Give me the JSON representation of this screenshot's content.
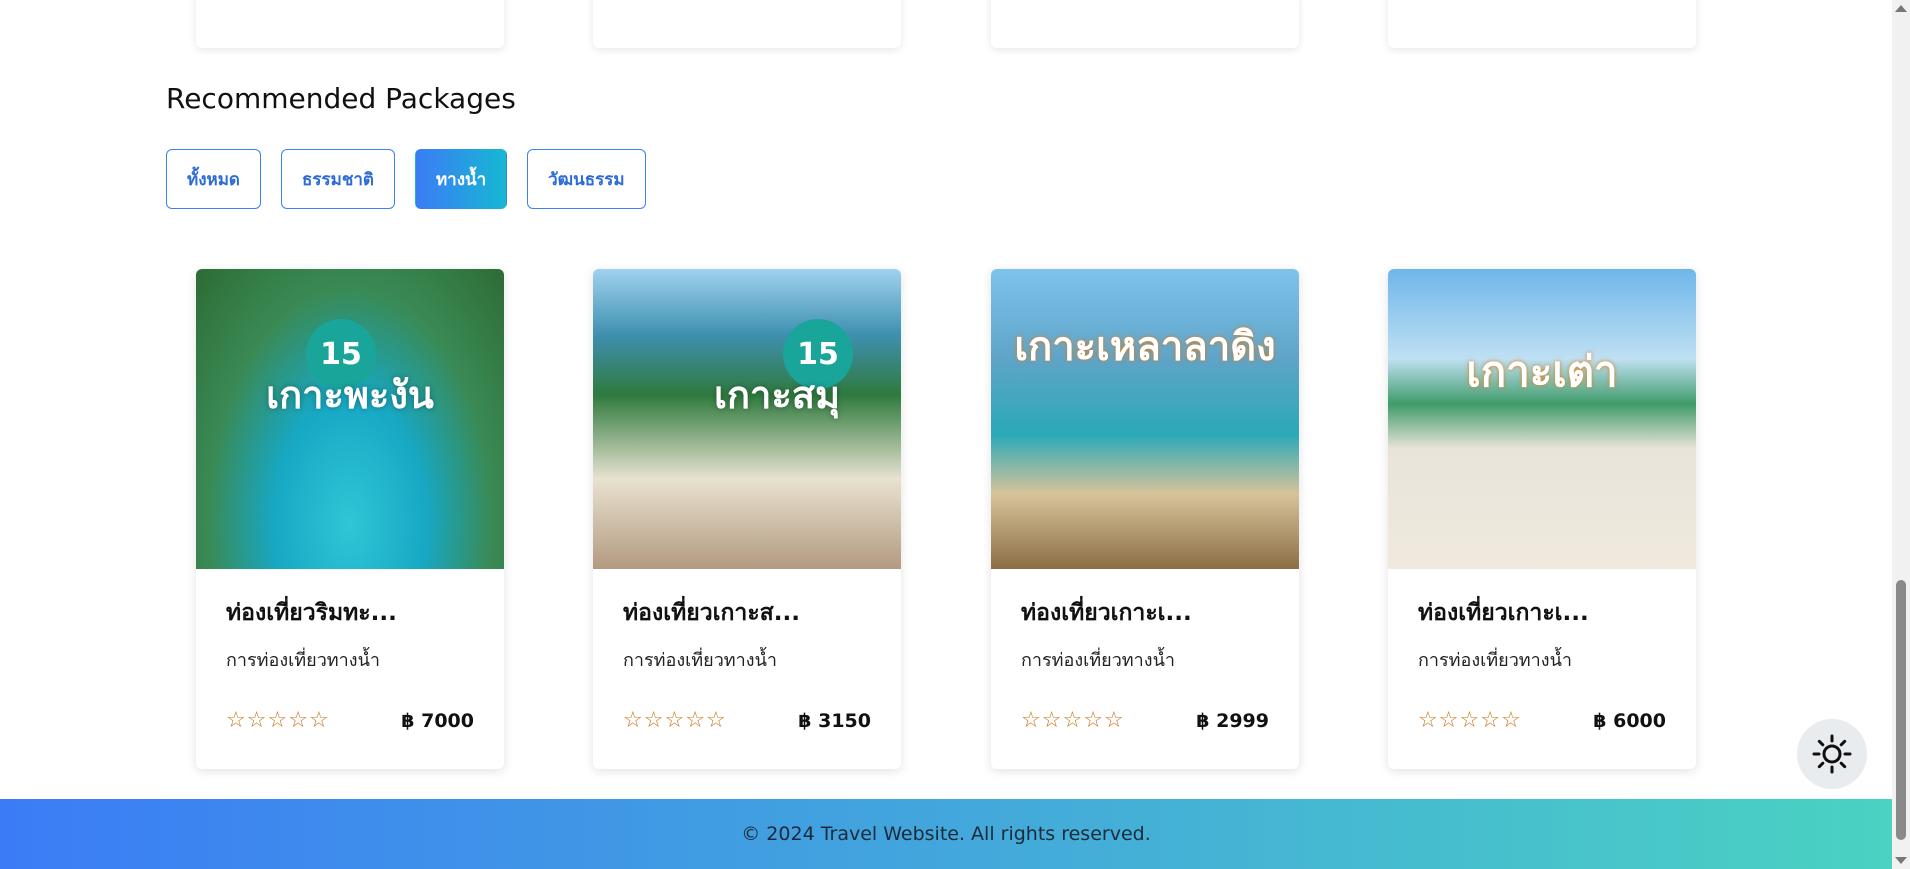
{
  "section": {
    "title": "Recommended Packages"
  },
  "filters": [
    {
      "label": "ทั้งหมด",
      "active": false
    },
    {
      "label": "ธรรมชาติ",
      "active": false
    },
    {
      "label": "ทางน้ำ",
      "active": true
    },
    {
      "label": "วัฒนธรรม",
      "active": false
    }
  ],
  "packages": [
    {
      "title": "ท่องเที่ยวริมทะ...",
      "category": "การท่องเที่ยวทางน้ำ",
      "price": "฿ 7000",
      "rating_stars": 5,
      "rating_filled": 0,
      "image_text": "เกาะพะงัน",
      "image_badge": "15"
    },
    {
      "title": "ท่องเที่ยวเกาะส...",
      "category": "การท่องเที่ยวทางน้ำ",
      "price": "฿ 3150",
      "rating_stars": 5,
      "rating_filled": 0,
      "image_text": "เกาะสมุ",
      "image_badge": "15"
    },
    {
      "title": "ท่องเที่ยวเกาะเ...",
      "category": "การท่องเที่ยวทางน้ำ",
      "price": "฿ 2999",
      "rating_stars": 5,
      "rating_filled": 0,
      "image_text": "เกาะเหลาลาดิง",
      "image_badge": ""
    },
    {
      "title": "ท่องเที่ยวเกาะเ...",
      "category": "การท่องเที่ยวทางน้ำ",
      "price": "฿ 6000",
      "rating_stars": 5,
      "rating_filled": 0,
      "image_text": "เกาะเต่า",
      "image_badge": ""
    }
  ],
  "footer": {
    "text": "© 2024 Travel Website. All rights reserved."
  },
  "icons": {
    "theme_toggle": "sun-icon",
    "star": "star-outline-icon"
  },
  "colors": {
    "accent": "#3b7cf6",
    "accent2": "#16b8d2",
    "star": "#c9781d"
  }
}
